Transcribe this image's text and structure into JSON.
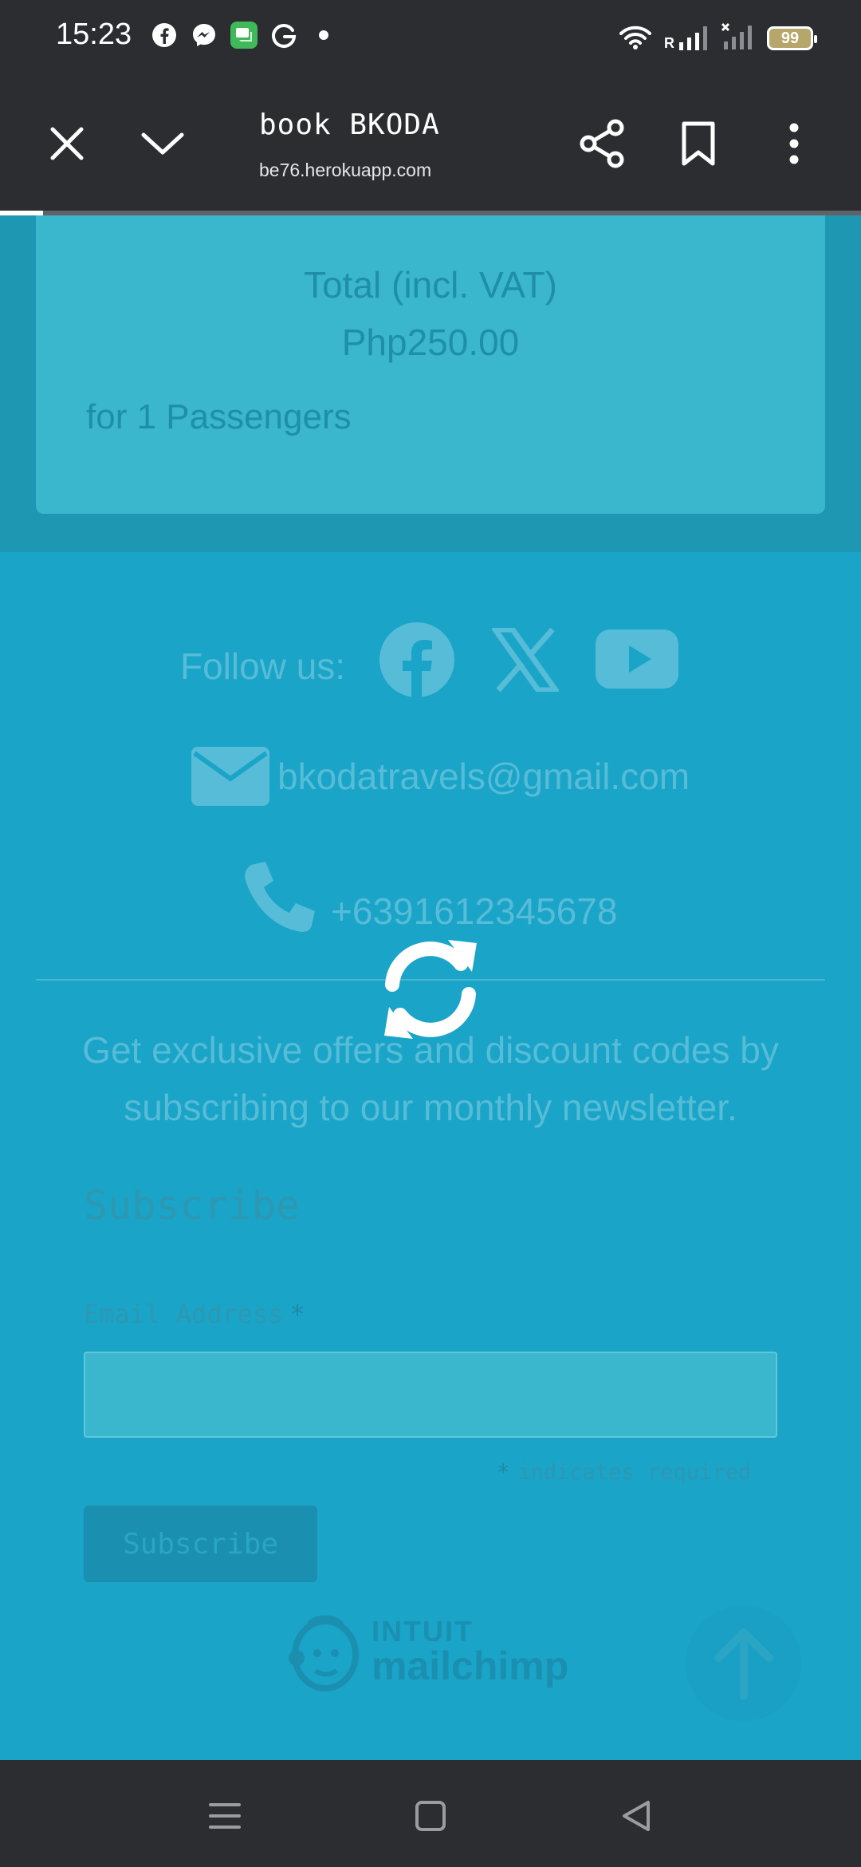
{
  "status_bar": {
    "time": "15:23",
    "notification_icons": [
      "facebook-icon",
      "messenger-icon",
      "chat-app-icon",
      "grammarly-icon",
      "dot-icon"
    ],
    "network_label": "R",
    "battery_level": "99"
  },
  "browser": {
    "page_title": "book BKODA",
    "url_faded": "",
    "url": "be76.herokuapp.com",
    "load_progress_percent": 5
  },
  "booking": {
    "total_label": "Total (incl. VAT)",
    "total_value": "Php250.00",
    "passengers_text": "for 1 Passengers"
  },
  "footer": {
    "follow_label": "Follow us:",
    "social_icons": [
      "facebook-icon",
      "x-icon",
      "youtube-icon"
    ],
    "email": "bkodatravels@gmail.com",
    "phone": "+6391612345678",
    "newsletter_text": "Get exclusive offers and discount codes by subscribing to our monthly newsletter."
  },
  "subscribe_form": {
    "title": "Subscribe",
    "email_label": "Email Address",
    "required_marker": "*",
    "email_value": "",
    "required_note": "indicates required",
    "button_label": "Subscribe"
  },
  "mailchimp": {
    "line1": "INTUIT",
    "line2": "mailchimp"
  },
  "colors": {
    "page_background": "#1aa4c8",
    "card_background": "#3ab6cd",
    "chrome_background": "#2b2d31"
  }
}
